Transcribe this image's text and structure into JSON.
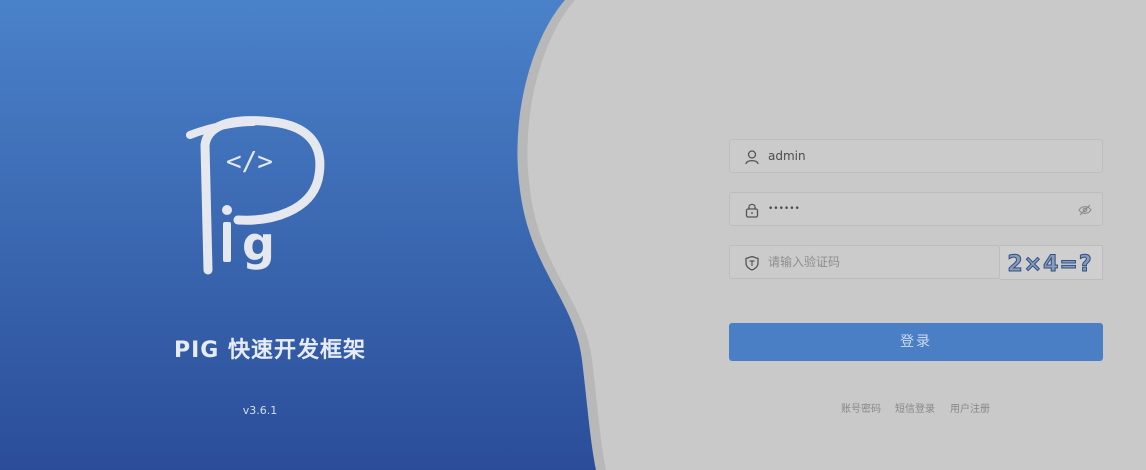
{
  "brand": {
    "title": "PIG 快速开发框架",
    "version": "v3.6.1",
    "logo_icon": "pig-logo-icon",
    "logo_text": "</>"
  },
  "login": {
    "username_value": "admin",
    "password_value": "••••••",
    "captcha_placeholder": "请输入验证码",
    "captcha_text": "2×4=?",
    "submit_label": "登录"
  },
  "links": {
    "account_login": "账号密码",
    "sms_login": "短信登录",
    "register": "用户注册"
  },
  "colors": {
    "brand_blue": "#3d6fbd",
    "button_blue": "#4a7fc6",
    "panel_gray": "#c9c9c9"
  }
}
